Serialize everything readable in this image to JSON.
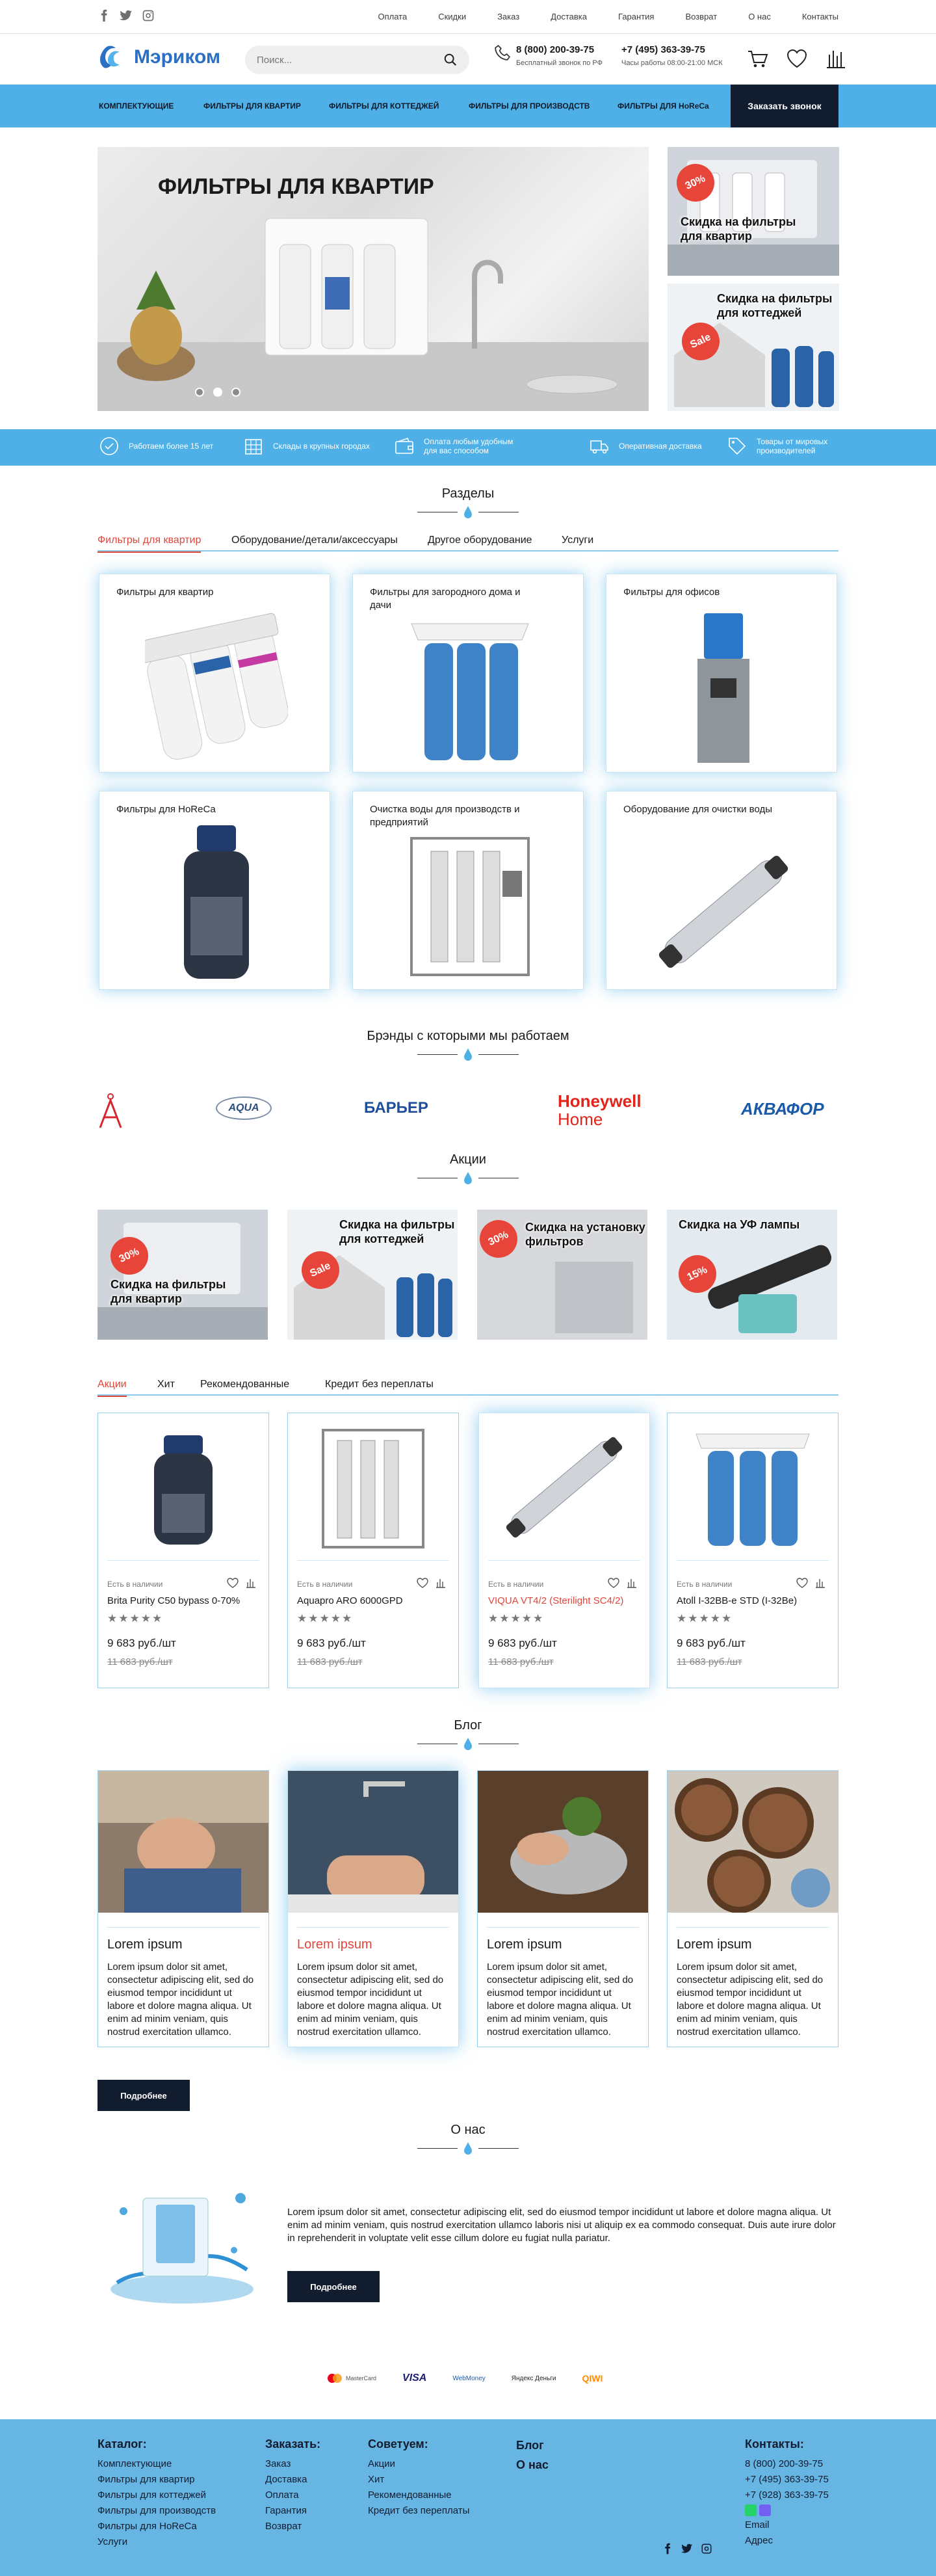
{
  "topbar": {
    "social": [
      "facebook-icon",
      "twitter-icon",
      "instagram-icon"
    ],
    "nav": [
      "Оплата",
      "Скидки",
      "Заказ",
      "Доставка",
      "Гарантия",
      "Возврат",
      "О нас",
      "Контакты"
    ]
  },
  "header": {
    "logo": "Мэриком",
    "search_placeholder": "Поиск...",
    "phone1": "8 (800) 200-39-75",
    "phone1_note": "Бесплатный звонок по РФ",
    "phone2": "+7 (495) 363-39-75",
    "phone2_note": "Часы работы 08:00-21:00 МСК"
  },
  "menu": {
    "items": [
      "КОМПЛЕКТУЮЩИЕ",
      "ФИЛЬТРЫ ДЛЯ КВАРТИР",
      "ФИЛЬТРЫ ДЛЯ КОТТЕДЖЕЙ",
      "ФИЛЬТРЫ ДЛЯ ПРОИЗВОДСТВ",
      "ФИЛЬТРЫ ДЛЯ HoReCa"
    ],
    "call": "Заказать звонок"
  },
  "hero": {
    "title": "ФИЛЬТРЫ ДЛЯ КВАРТИР",
    "slide_index": 2,
    "slides": 3,
    "promo1_badge": "30%",
    "promo1_text": "Скидка на фильтры для квартир",
    "promo2_badge": "Sale",
    "promo2_text": "Скидка на фильтры для коттеджей"
  },
  "features": [
    "Работаем более 15 лет",
    "Склады в крупных городах",
    "Оплата любым удобным для вас способом",
    "Оперативная доставка",
    "Товары от мировых производителей"
  ],
  "sections": {
    "title": "Разделы",
    "tabs": [
      "Фильтры для квартир",
      "Оборудование/детали/аксессуары",
      "Другое оборудование",
      "Услуги"
    ],
    "cards": [
      "Фильтры для квартир",
      "Фильтры для загородного дома и дачи",
      "Фильтры для офисов",
      "Фильтры для HoReCa",
      "Очистка воды для производств и предприятий",
      "Оборудование для очистки воды"
    ]
  },
  "brands": {
    "title": "Брэнды с которыми мы работаем",
    "items": [
      "AQUA",
      "БАРЬЕР",
      "Honeywell",
      "Home",
      "АКВАФОР"
    ]
  },
  "promos": {
    "title": "Акции",
    "items": [
      {
        "badge": "30%",
        "text": "Скидка на фильтры для квартир"
      },
      {
        "badge": "Sale",
        "text": "Скидка на фильтры для коттеджей"
      },
      {
        "badge": "30%",
        "text": "Скидка на установку фильтров"
      },
      {
        "badge": "15%",
        "text": "Скидка на УФ лампы"
      }
    ]
  },
  "products": {
    "tabs": [
      "Акции",
      "Хит",
      "Рекомендованные",
      "Кредит без переплаты"
    ],
    "items": [
      {
        "avail": "Есть в наличии",
        "name": "Brita Purity C50 bypass 0-70%",
        "stars": "★★★★★",
        "price": "9 683 руб./шт",
        "old": "11 683 руб./шт"
      },
      {
        "avail": "Есть в наличии",
        "name": "Aquapro ARO 6000GPD",
        "stars": "★★★★★",
        "price": "9 683 руб./шт",
        "old": "11 683 руб./шт"
      },
      {
        "avail": "Есть в наличии",
        "name": "VIQUA VT4/2 (Sterilight SC4/2)",
        "stars": "★★★★★",
        "price": "9 683 руб./шт",
        "old": "11 683 руб./шт"
      },
      {
        "avail": "Есть в наличии",
        "name": "Atoll I-32BB-e STD (I-32Be)",
        "stars": "★★★★★",
        "price": "9 683 руб./шт",
        "old": "11 683 руб./шт"
      }
    ]
  },
  "blog": {
    "title": "Блог",
    "items": [
      {
        "title": "Lorem ipsum",
        "text": "Lorem ipsum dolor sit amet, consectetur adipiscing elit, sed do eiusmod tempor incididunt ut labore et dolore magna aliqua. Ut enim ad minim veniam, quis nostrud exercitation ullamco."
      },
      {
        "title": "Lorem ipsum",
        "text": "Lorem ipsum dolor sit amet, consectetur adipiscing elit, sed do eiusmod tempor incididunt ut labore et dolore magna aliqua. Ut enim ad minim veniam, quis nostrud exercitation ullamco."
      },
      {
        "title": "Lorem ipsum",
        "text": "Lorem ipsum dolor sit amet, consectetur adipiscing elit, sed do eiusmod tempor incididunt ut labore et dolore magna aliqua. Ut enim ad minim veniam, quis nostrud exercitation ullamco."
      },
      {
        "title": "Lorem ipsum",
        "text": "Lorem ipsum dolor sit amet, consectetur adipiscing elit, sed do eiusmod tempor incididunt ut labore et dolore magna aliqua. Ut enim ad minim veniam, quis nostrud exercitation ullamco."
      }
    ],
    "more": "Подробнее"
  },
  "about": {
    "title": "О нас",
    "text": "Lorem ipsum dolor sit amet, consectetur adipiscing elit, sed do eiusmod tempor incididunt ut labore et dolore magna aliqua. Ut enim ad minim veniam, quis nostrud exercitation ullamco laboris nisi ut aliquip ex ea commodo consequat. Duis aute irure dolor in reprehenderit in voluptate velit esse cillum dolore eu fugiat nulla pariatur.",
    "more": "Подробнее"
  },
  "payments": [
    "MasterCard",
    "VISA",
    "WebMoney",
    "Яндекс Деньги",
    "QIWI"
  ],
  "footer": {
    "catalog_title": "Каталог:",
    "catalog": [
      "Комплектующие",
      "Фильтры для квартир",
      "Фильтры для коттеджей",
      "Фильтры для производств",
      "Фильтры для HoReCa",
      "Услуги"
    ],
    "order_title": "Заказать:",
    "order": [
      "Заказ",
      "Доставка",
      "Оплата",
      "Гарантия",
      "Возврат"
    ],
    "advise_title": "Советуем:",
    "advise": [
      "Акции",
      "Хит",
      "Рекомендованные",
      "Кредит без переплаты"
    ],
    "blog": "Блог",
    "about": "О нас",
    "contacts_title": "Контакты:",
    "contacts": [
      "8 (800) 200-39-75",
      "+7 (495) 363-39-75",
      "+7 (928) 363-39-75",
      "Email",
      "Адрес"
    ]
  },
  "colors": {
    "accent": "#4eb0e6",
    "dark": "#121c2f",
    "red": "#e1463b"
  }
}
